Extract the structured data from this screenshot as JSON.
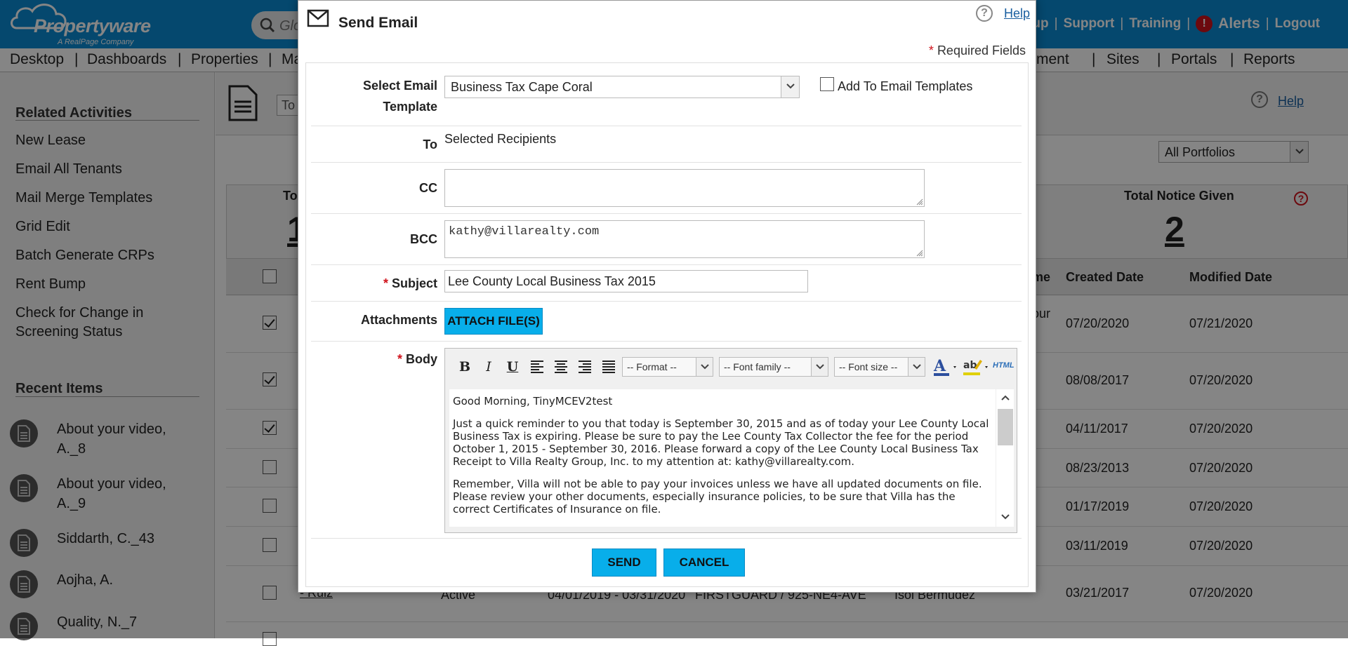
{
  "app": {
    "logo_text": "Propertyware",
    "logo_sub": "A RealPage Company",
    "search_placeholder": "Glo"
  },
  "top_links": {
    "setup": "Setup",
    "support": "Support",
    "training": "Training",
    "alerts": "Alerts",
    "logout": "Logout",
    "separator": "|",
    "alert_badge": "!"
  },
  "main_nav": {
    "items": [
      "Desktop",
      "Dashboards",
      "Properties",
      "Ma",
      "ment",
      "Sites",
      "Portals",
      "Reports"
    ],
    "separator": "|"
  },
  "sidebar": {
    "related_title": "Related Activities",
    "related": [
      "New Lease",
      "Email All Tenants",
      "Mail Merge Templates",
      "Grid Edit",
      "Batch Generate CRPs",
      "Rent Bump",
      "Check for Change in Screening Status"
    ],
    "recent_title": "Recent Items",
    "recent": [
      "About your video, A._8",
      "About your video, A._9",
      "Siddarth, C._43",
      "Aojha, A.",
      "Quality, N._7"
    ]
  },
  "background": {
    "to_input": "To",
    "help": "Help",
    "portfolio": "All Portfolios",
    "stat_left_title": "To",
    "stat_left_num": "1",
    "stat_right_title": "Total Notice Given",
    "stat_right_num": "2",
    "headers": {
      "col_name_partial": "me",
      "created": "Created Date",
      "modified": "Modified Date"
    },
    "rows": [
      {
        "checked": true,
        "note": "our",
        "created": "07/20/2020",
        "modified": "07/21/2020"
      },
      {
        "checked": true,
        "note": "",
        "created": "08/08/2017",
        "modified": "07/20/2020"
      },
      {
        "checked": true,
        "note": "",
        "created": "04/11/2017",
        "modified": "07/20/2020"
      },
      {
        "checked": false,
        "note": "",
        "created": "08/23/2013",
        "modified": "07/20/2020"
      },
      {
        "checked": false,
        "note": "",
        "created": "01/17/2019",
        "modified": "07/20/2020"
      },
      {
        "checked": false,
        "note": "",
        "created": "03/11/2019",
        "modified": "07/20/2020"
      },
      {
        "checked": false,
        "note": "",
        "created": "03/21/2017",
        "modified": "07/20/2020"
      }
    ],
    "last_row": {
      "name": "- Ruiz",
      "status": "Active",
      "dates": "04/01/2019 - 03/31/2020",
      "unit": "FIRSTGUARD / 925-NE4-AVE",
      "agent": "Isol Bermudez"
    }
  },
  "modal": {
    "title": "Send Email",
    "help": "Help",
    "required_star": "*",
    "required_note": "Required Fields",
    "labels": {
      "template": "Select Email Template",
      "to": "To",
      "cc": "CC",
      "bcc": "BCC",
      "subject": "Subject",
      "attachments": "Attachments",
      "body": "Body"
    },
    "template_value": "Business Tax Cape Coral",
    "add_template_label": "Add To Email Templates",
    "to_value": "Selected Recipients",
    "cc_value": "",
    "bcc_value": "kathy@villarealty.com",
    "subject_value": "Lee County Local Business Tax 2015",
    "attach_button": "ATTACH FILE(S)",
    "toolbar": {
      "bold": "B",
      "italic": "I",
      "underline": "U",
      "format": "-- Format --",
      "font_family": "-- Font family --",
      "font_size": "-- Font size --",
      "html": "HTML"
    },
    "body": {
      "p1": "Good Morning, TinyMCEV2test",
      "p2": "Just a quick reminder to you that today is September 30, 2015 and as of today your Lee County Local Business Tax is expiring.  Please be sure to pay the Lee County Tax Collector the fee for the period October 1, 2015 - September 30, 2016. Please forward a copy of the Lee County Local Business Tax Receipt to Villa Realty Group, Inc. to my attention at: kathy@villarealty.com.",
      "p3": "Remember, Villa will not be able to pay your invoices unless we have all updated documents on file.  Please review your other documents, especially insurance policies, to be sure that Villa has the correct Certificates of Insurance on file."
    },
    "send_button": "SEND",
    "cancel_button": "CANCEL"
  },
  "colors": {
    "brand_blue": "#0a8bd4",
    "button_blue": "#08aeea",
    "alert_red": "#d0131c",
    "required_red": "#d0131c"
  }
}
